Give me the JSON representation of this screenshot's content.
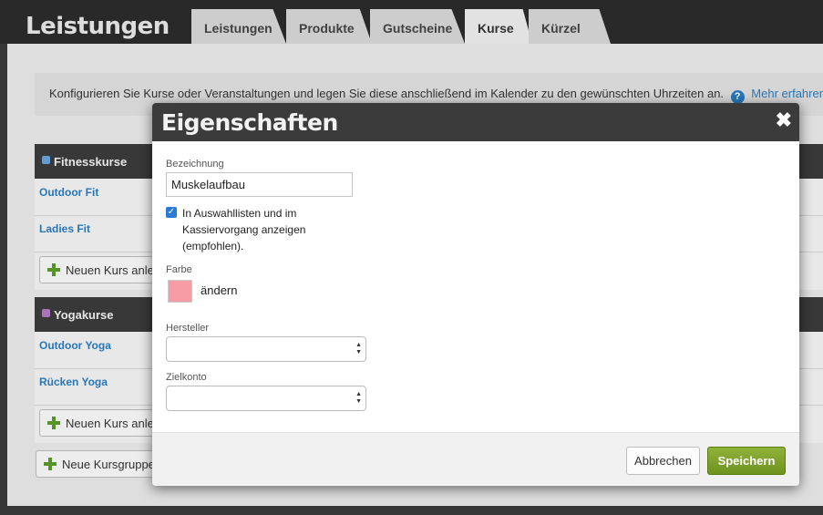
{
  "app": {
    "title": "Leistungen"
  },
  "tabs": [
    {
      "label": "Leistungen"
    },
    {
      "label": "Produkte"
    },
    {
      "label": "Gutscheine"
    },
    {
      "label": "Kurse",
      "active": true
    },
    {
      "label": "Kürzel"
    }
  ],
  "info": {
    "text": "Konfigurieren Sie Kurse oder Veranstaltungen und legen Sie diese anschließend im Kalender zu den gewünschten Uhrzeiten an.",
    "help_glyph": "?",
    "more_link": "Mehr erfahren"
  },
  "groups": [
    {
      "title": "Fitnesskurse",
      "color": "#6aa3d8",
      "courses": [
        {
          "name": "Outdoor Fit"
        },
        {
          "name": "Ladies Fit"
        }
      ],
      "add_label": "Neuen Kurs anlegen",
      "right_glyph": "e"
    },
    {
      "title": "Yogakurse",
      "color": "#b07ac0",
      "courses": [
        {
          "name": "Outdoor Yoga"
        },
        {
          "name": "Rücken Yoga"
        }
      ],
      "add_label": "Neuen Kurs anlegen",
      "right_glyph": "e"
    }
  ],
  "new_group_label": "Neue Kursgruppe",
  "modal": {
    "title": "Eigenschaften",
    "close_glyph": "✖",
    "name_label": "Bezeichnung",
    "name_value": "Muskelaufbau",
    "checkbox_label": "In Auswahllisten und im Kassiervorgang anzeigen (empfohlen).",
    "checkbox_checked": true,
    "color_label": "Farbe",
    "color_value": "#f79ba5",
    "change_label": "ändern",
    "manufacturer_label": "Hersteller",
    "manufacturer_value": "",
    "account_label": "Zielkonto",
    "account_value": "",
    "cancel_label": "Abbrechen",
    "save_label": "Speichern"
  }
}
